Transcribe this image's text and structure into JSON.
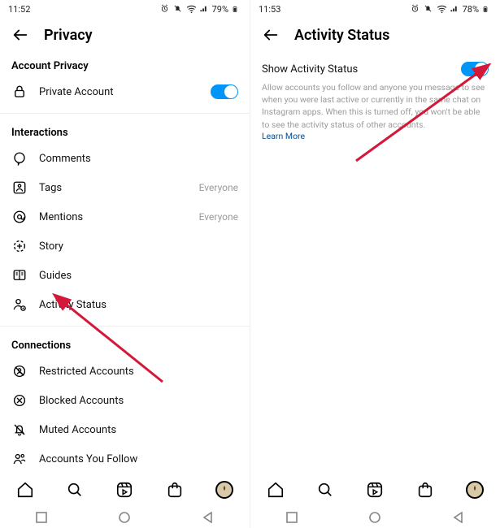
{
  "left": {
    "statusbar": {
      "time": "11:52",
      "battery": "79%"
    },
    "header": {
      "title": "Privacy"
    },
    "sectionAccount": {
      "heading": "Account Privacy",
      "privateAccount": "Private Account"
    },
    "sectionInteractions": {
      "heading": "Interactions",
      "comments": "Comments",
      "tags": "Tags",
      "tagsValue": "Everyone",
      "mentions": "Mentions",
      "mentionsValue": "Everyone",
      "story": "Story",
      "guides": "Guides",
      "activityStatus": "Activity Status"
    },
    "sectionConnections": {
      "heading": "Connections",
      "restricted": "Restricted Accounts",
      "blocked": "Blocked Accounts",
      "muted": "Muted Accounts",
      "following": "Accounts You Follow"
    }
  },
  "right": {
    "statusbar": {
      "time": "11:53",
      "battery": "78%"
    },
    "header": {
      "title": "Activity Status"
    },
    "body": {
      "toggleLabel": "Show Activity Status",
      "helper": "Allow accounts you follow and anyone you message to see when you were last active or currently in the same chat on Instagram apps. When this is turned off, you won't be able to see the activity status of other accounts.",
      "learnMore": "Learn More"
    }
  }
}
